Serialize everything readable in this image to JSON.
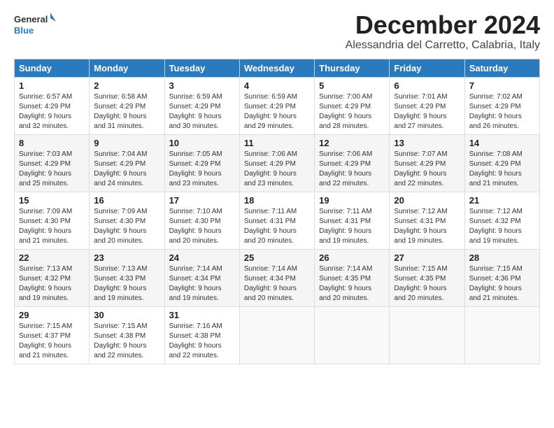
{
  "header": {
    "logo_general": "General",
    "logo_blue": "Blue",
    "month": "December 2024",
    "location": "Alessandria del Carretto, Calabria, Italy"
  },
  "weekdays": [
    "Sunday",
    "Monday",
    "Tuesday",
    "Wednesday",
    "Thursday",
    "Friday",
    "Saturday"
  ],
  "weeks": [
    [
      {
        "day": "1",
        "info": "Sunrise: 6:57 AM\nSunset: 4:29 PM\nDaylight: 9 hours\nand 32 minutes."
      },
      {
        "day": "2",
        "info": "Sunrise: 6:58 AM\nSunset: 4:29 PM\nDaylight: 9 hours\nand 31 minutes."
      },
      {
        "day": "3",
        "info": "Sunrise: 6:59 AM\nSunset: 4:29 PM\nDaylight: 9 hours\nand 30 minutes."
      },
      {
        "day": "4",
        "info": "Sunrise: 6:59 AM\nSunset: 4:29 PM\nDaylight: 9 hours\nand 29 minutes."
      },
      {
        "day": "5",
        "info": "Sunrise: 7:00 AM\nSunset: 4:29 PM\nDaylight: 9 hours\nand 28 minutes."
      },
      {
        "day": "6",
        "info": "Sunrise: 7:01 AM\nSunset: 4:29 PM\nDaylight: 9 hours\nand 27 minutes."
      },
      {
        "day": "7",
        "info": "Sunrise: 7:02 AM\nSunset: 4:29 PM\nDaylight: 9 hours\nand 26 minutes."
      }
    ],
    [
      {
        "day": "8",
        "info": "Sunrise: 7:03 AM\nSunset: 4:29 PM\nDaylight: 9 hours\nand 25 minutes."
      },
      {
        "day": "9",
        "info": "Sunrise: 7:04 AM\nSunset: 4:29 PM\nDaylight: 9 hours\nand 24 minutes."
      },
      {
        "day": "10",
        "info": "Sunrise: 7:05 AM\nSunset: 4:29 PM\nDaylight: 9 hours\nand 23 minutes."
      },
      {
        "day": "11",
        "info": "Sunrise: 7:06 AM\nSunset: 4:29 PM\nDaylight: 9 hours\nand 23 minutes."
      },
      {
        "day": "12",
        "info": "Sunrise: 7:06 AM\nSunset: 4:29 PM\nDaylight: 9 hours\nand 22 minutes."
      },
      {
        "day": "13",
        "info": "Sunrise: 7:07 AM\nSunset: 4:29 PM\nDaylight: 9 hours\nand 22 minutes."
      },
      {
        "day": "14",
        "info": "Sunrise: 7:08 AM\nSunset: 4:29 PM\nDaylight: 9 hours\nand 21 minutes."
      }
    ],
    [
      {
        "day": "15",
        "info": "Sunrise: 7:09 AM\nSunset: 4:30 PM\nDaylight: 9 hours\nand 21 minutes."
      },
      {
        "day": "16",
        "info": "Sunrise: 7:09 AM\nSunset: 4:30 PM\nDaylight: 9 hours\nand 20 minutes."
      },
      {
        "day": "17",
        "info": "Sunrise: 7:10 AM\nSunset: 4:30 PM\nDaylight: 9 hours\nand 20 minutes."
      },
      {
        "day": "18",
        "info": "Sunrise: 7:11 AM\nSunset: 4:31 PM\nDaylight: 9 hours\nand 20 minutes."
      },
      {
        "day": "19",
        "info": "Sunrise: 7:11 AM\nSunset: 4:31 PM\nDaylight: 9 hours\nand 19 minutes."
      },
      {
        "day": "20",
        "info": "Sunrise: 7:12 AM\nSunset: 4:31 PM\nDaylight: 9 hours\nand 19 minutes."
      },
      {
        "day": "21",
        "info": "Sunrise: 7:12 AM\nSunset: 4:32 PM\nDaylight: 9 hours\nand 19 minutes."
      }
    ],
    [
      {
        "day": "22",
        "info": "Sunrise: 7:13 AM\nSunset: 4:32 PM\nDaylight: 9 hours\nand 19 minutes."
      },
      {
        "day": "23",
        "info": "Sunrise: 7:13 AM\nSunset: 4:33 PM\nDaylight: 9 hours\nand 19 minutes."
      },
      {
        "day": "24",
        "info": "Sunrise: 7:14 AM\nSunset: 4:34 PM\nDaylight: 9 hours\nand 19 minutes."
      },
      {
        "day": "25",
        "info": "Sunrise: 7:14 AM\nSunset: 4:34 PM\nDaylight: 9 hours\nand 20 minutes."
      },
      {
        "day": "26",
        "info": "Sunrise: 7:14 AM\nSunset: 4:35 PM\nDaylight: 9 hours\nand 20 minutes."
      },
      {
        "day": "27",
        "info": "Sunrise: 7:15 AM\nSunset: 4:35 PM\nDaylight: 9 hours\nand 20 minutes."
      },
      {
        "day": "28",
        "info": "Sunrise: 7:15 AM\nSunset: 4:36 PM\nDaylight: 9 hours\nand 21 minutes."
      }
    ],
    [
      {
        "day": "29",
        "info": "Sunrise: 7:15 AM\nSunset: 4:37 PM\nDaylight: 9 hours\nand 21 minutes."
      },
      {
        "day": "30",
        "info": "Sunrise: 7:15 AM\nSunset: 4:38 PM\nDaylight: 9 hours\nand 22 minutes."
      },
      {
        "day": "31",
        "info": "Sunrise: 7:16 AM\nSunset: 4:38 PM\nDaylight: 9 hours\nand 22 minutes."
      },
      null,
      null,
      null,
      null
    ]
  ]
}
